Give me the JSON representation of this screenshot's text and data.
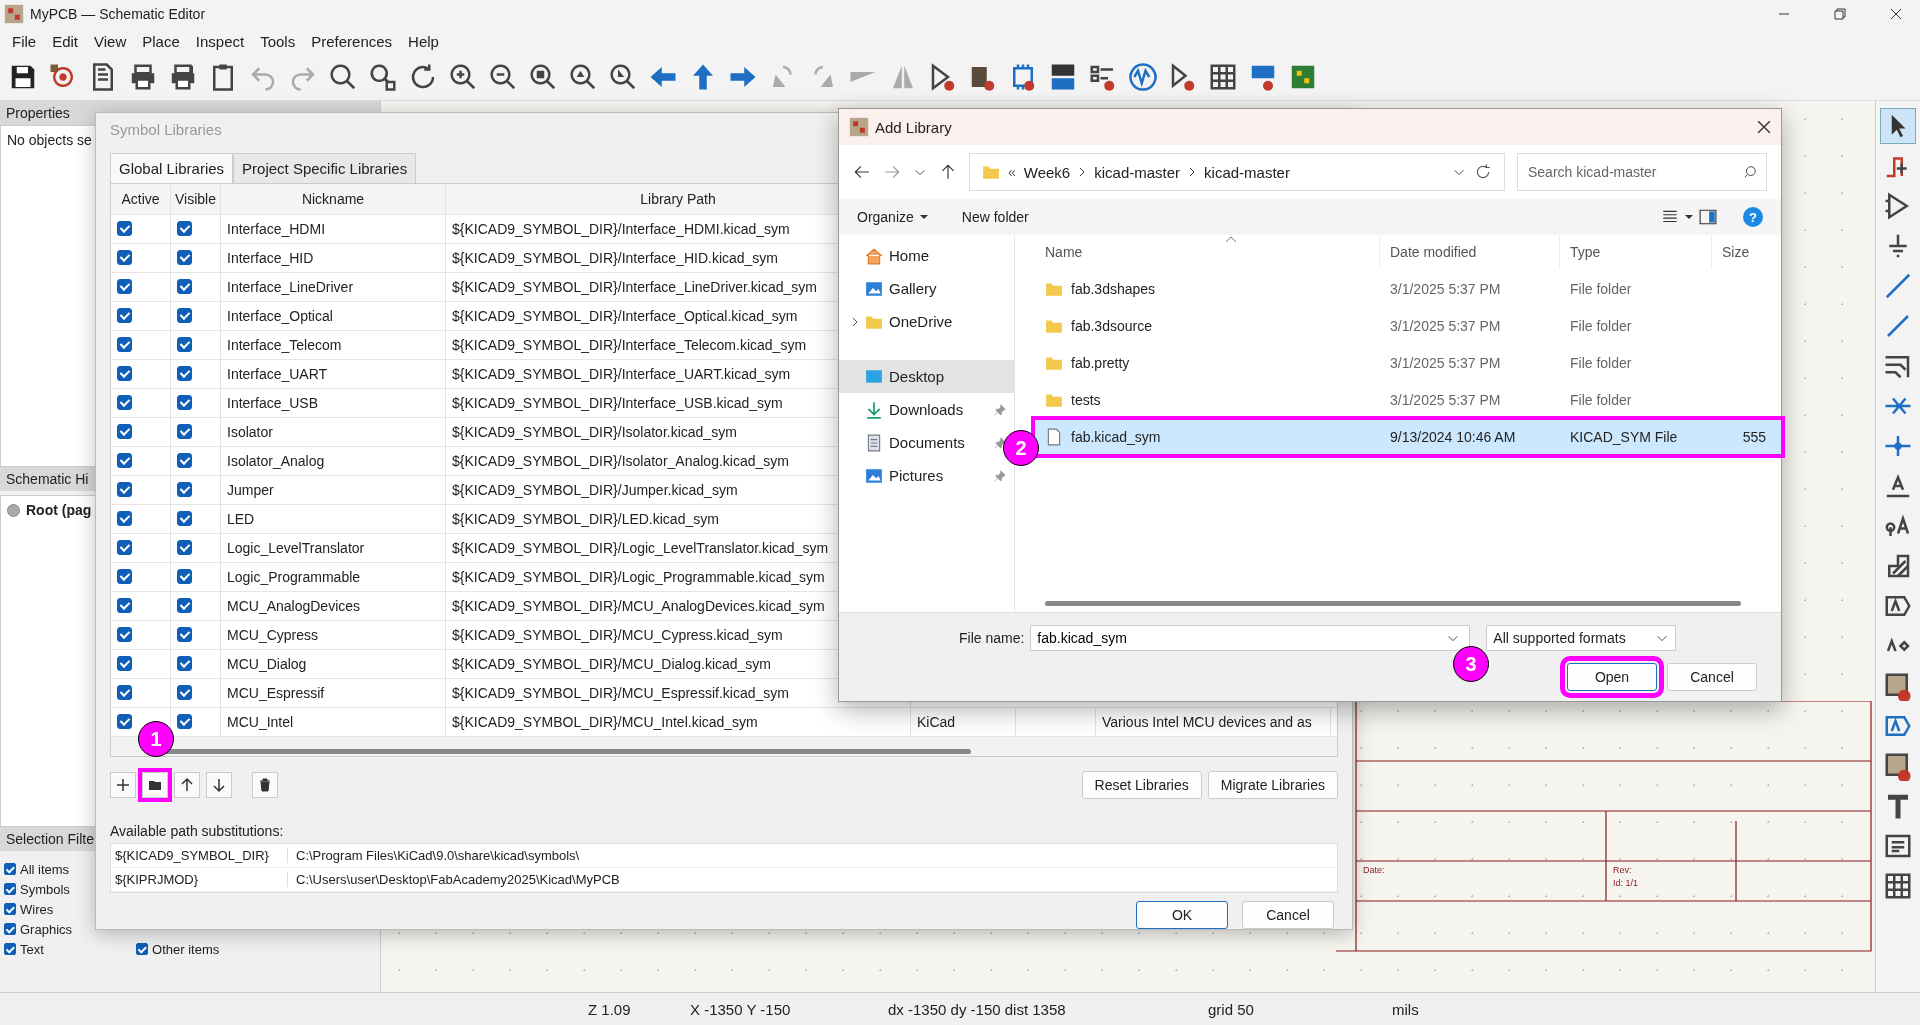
{
  "window": {
    "title": "MyPCB — Schematic Editor"
  },
  "menu": [
    "File",
    "Edit",
    "View",
    "Place",
    "Inspect",
    "Tools",
    "Preferences",
    "Help"
  ],
  "properties_panel": {
    "title": "Properties",
    "text": "No objects se"
  },
  "hierarchy_panel": {
    "title": "Schematic Hi",
    "items": [
      {
        "label": "Root (pag",
        "selected": true
      }
    ]
  },
  "selection_filter": {
    "title": "Selection Filte",
    "items": [
      {
        "label": "All items",
        "checked": true
      },
      {
        "label": "Symbols",
        "checked": true
      },
      {
        "label": "Wires",
        "checked": true
      },
      {
        "label": "Graphics",
        "checked": true
      },
      {
        "label": "Text",
        "checked": true
      }
    ],
    "other": {
      "label": "Other items",
      "checked": true
    }
  },
  "title_block": [
    "Date:",
    "Rev:",
    "Id: 1/1"
  ],
  "symbol_libraries": {
    "title": "Symbol Libraries",
    "tabs": [
      {
        "label": "Global Libraries",
        "selected": true
      },
      {
        "label": "Project Specific Libraries",
        "selected": false
      }
    ],
    "columns": [
      "Active",
      "Visible",
      "Nickname",
      "Library Path"
    ],
    "rows": [
      {
        "active": true,
        "visible": true,
        "nickname": "Interface_HDMI",
        "path": "${KICAD9_SYMBOL_DIR}/Interface_HDMI.kicad_sym"
      },
      {
        "active": true,
        "visible": true,
        "nickname": "Interface_HID",
        "path": "${KICAD9_SYMBOL_DIR}/Interface_HID.kicad_sym"
      },
      {
        "active": true,
        "visible": true,
        "nickname": "Interface_LineDriver",
        "path": "${KICAD9_SYMBOL_DIR}/Interface_LineDriver.kicad_sym"
      },
      {
        "active": true,
        "visible": true,
        "nickname": "Interface_Optical",
        "path": "${KICAD9_SYMBOL_DIR}/Interface_Optical.kicad_sym"
      },
      {
        "active": true,
        "visible": true,
        "nickname": "Interface_Telecom",
        "path": "${KICAD9_SYMBOL_DIR}/Interface_Telecom.kicad_sym"
      },
      {
        "active": true,
        "visible": true,
        "nickname": "Interface_UART",
        "path": "${KICAD9_SYMBOL_DIR}/Interface_UART.kicad_sym"
      },
      {
        "active": true,
        "visible": true,
        "nickname": "Interface_USB",
        "path": "${KICAD9_SYMBOL_DIR}/Interface_USB.kicad_sym"
      },
      {
        "active": true,
        "visible": true,
        "nickname": "Isolator",
        "path": "${KICAD9_SYMBOL_DIR}/Isolator.kicad_sym"
      },
      {
        "active": true,
        "visible": true,
        "nickname": "Isolator_Analog",
        "path": "${KICAD9_SYMBOL_DIR}/Isolator_Analog.kicad_sym"
      },
      {
        "active": true,
        "visible": true,
        "nickname": "Jumper",
        "path": "${KICAD9_SYMBOL_DIR}/Jumper.kicad_sym"
      },
      {
        "active": true,
        "visible": true,
        "nickname": "LED",
        "path": "${KICAD9_SYMBOL_DIR}/LED.kicad_sym"
      },
      {
        "active": true,
        "visible": true,
        "nickname": "Logic_LevelTranslator",
        "path": "${KICAD9_SYMBOL_DIR}/Logic_LevelTranslator.kicad_sym"
      },
      {
        "active": true,
        "visible": true,
        "nickname": "Logic_Programmable",
        "path": "${KICAD9_SYMBOL_DIR}/Logic_Programmable.kicad_sym"
      },
      {
        "active": true,
        "visible": true,
        "nickname": "MCU_AnalogDevices",
        "path": "${KICAD9_SYMBOL_DIR}/MCU_AnalogDevices.kicad_sym"
      },
      {
        "active": true,
        "visible": true,
        "nickname": "MCU_Cypress",
        "path": "${KICAD9_SYMBOL_DIR}/MCU_Cypress.kicad_sym"
      },
      {
        "active": true,
        "visible": true,
        "nickname": "MCU_Dialog",
        "path": "${KICAD9_SYMBOL_DIR}/MCU_Dialog.kicad_sym"
      },
      {
        "active": true,
        "visible": true,
        "nickname": "MCU_Espressif",
        "path": "${KICAD9_SYMBOL_DIR}/MCU_Espressif.kicad_sym"
      },
      {
        "active": true,
        "visible": true,
        "nickname": "MCU_Intel",
        "path": "${KICAD9_SYMBOL_DIR}/MCU_Intel.kicad_sym",
        "plugin": "KiCad",
        "description": "Various Intel MCU devices and as"
      }
    ],
    "tools": [
      {
        "kind": "add",
        "highlighted": false
      },
      {
        "kind": "folder",
        "highlighted": true
      },
      {
        "kind": "up",
        "highlighted": false
      },
      {
        "kind": "down",
        "highlighted": false
      },
      {
        "kind": "delete",
        "highlighted": false
      }
    ],
    "buttons": [
      "Reset Libraries",
      "Migrate Libraries"
    ],
    "substitutions_label": "Available path substitutions:",
    "substitutions": [
      {
        "name": "${KICAD9_SYMBOL_DIR}",
        "value": "C:\\Program Files\\KiCad\\9.0\\share\\kicad\\symbols\\"
      },
      {
        "name": "${KIPRJMOD}",
        "value": "C:\\Users\\user\\Desktop\\FabAcademy2025\\Kicad\\MyPCB"
      }
    ],
    "ok": "OK",
    "cancel": "Cancel"
  },
  "add_library": {
    "title": "Add Library",
    "crumb_prefix": "«",
    "breadcrumb": [
      "Week6",
      "kicad-master",
      "kicad-master"
    ],
    "search_placeholder": "Search kicad-master",
    "organize": "Organize",
    "new_folder": "New folder",
    "help": "?",
    "nav": [
      {
        "label": "Home",
        "selected": false,
        "pinned": false,
        "expandable": false
      },
      {
        "label": "Gallery",
        "selected": false,
        "pinned": false,
        "expandable": false
      },
      {
        "label": "OneDrive",
        "selected": false,
        "pinned": false,
        "expandable": true
      },
      {
        "label": "Desktop",
        "selected": true,
        "pinned": false,
        "expandable": false
      },
      {
        "label": "Downloads",
        "selected": false,
        "pinned": true,
        "expandable": false
      },
      {
        "label": "Documents",
        "selected": false,
        "pinned": true,
        "expandable": false
      },
      {
        "label": "Pictures",
        "selected": false,
        "pinned": true,
        "expandable": false
      }
    ],
    "columns": [
      "Name",
      "Date modified",
      "Type",
      "Size"
    ],
    "files": [
      {
        "kind": "folder",
        "name": "fab.3dshapes",
        "date": "3/1/2025 5:37 PM",
        "type": "File folder",
        "selected": false,
        "highlighted": false
      },
      {
        "kind": "folder",
        "name": "fab.3dsource",
        "date": "3/1/2025 5:37 PM",
        "type": "File folder",
        "selected": false,
        "highlighted": false
      },
      {
        "kind": "folder",
        "name": "fab.pretty",
        "date": "3/1/2025 5:37 PM",
        "type": "File folder",
        "selected": false,
        "highlighted": false
      },
      {
        "kind": "folder",
        "name": "tests",
        "date": "3/1/2025 5:37 PM",
        "type": "File folder",
        "selected": false,
        "highlighted": false
      },
      {
        "kind": "file",
        "name": "fab.kicad_sym",
        "date": "9/13/2024 10:46 AM",
        "type": "KICAD_SYM File",
        "size": "555",
        "selected": true,
        "highlighted": true
      }
    ],
    "file_name_label": "File name:",
    "file_name": "fab.kicad_sym",
    "filter": "All supported formats",
    "open": {
      "label": "Open",
      "highlighted": true
    },
    "cancel": "Cancel"
  },
  "step_badges": [
    "1",
    "2",
    "3"
  ],
  "status_bar": [
    "Z 1.09",
    "X -1350  Y -150",
    "dx -1350  dy -150  dist 1358",
    "grid 50",
    "mils"
  ]
}
